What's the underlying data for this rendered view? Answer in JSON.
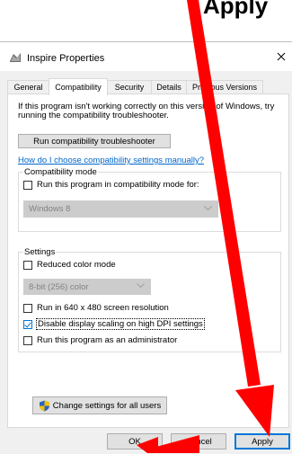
{
  "caption": {
    "text": "Apply"
  },
  "window": {
    "title": "Inspire Properties",
    "app_icon": "app-icon",
    "close_symbol": "✕"
  },
  "tabs": [
    {
      "label": "General",
      "active": false
    },
    {
      "label": "Compatibility",
      "active": true
    },
    {
      "label": "Security",
      "active": false
    },
    {
      "label": "Details",
      "active": false
    },
    {
      "label": "Previous Versions",
      "active": false
    }
  ],
  "compat": {
    "intro_text": "If this program isn't working correctly on this version of Windows, try running the compatibility troubleshooter.",
    "troubleshooter_button": "Run compatibility troubleshooter",
    "help_link": "How do I choose compatibility settings manually?",
    "mode_group": {
      "label": "Compatibility mode",
      "checkbox_label": "Run this program in compatibility mode for:",
      "checked": false,
      "os_select_value": "Windows 8"
    },
    "settings_group": {
      "label": "Settings",
      "reduced_color_label": "Reduced color mode",
      "reduced_color_checked": false,
      "color_select_value": "8-bit (256) color",
      "run_640_label": "Run in 640 x 480 screen resolution",
      "run_640_checked": false,
      "dpi_label": "Disable display scaling on high DPI settings",
      "dpi_checked": true,
      "admin_label": "Run this program as an administrator",
      "admin_checked": false
    },
    "all_users_button": "Change settings for all users"
  },
  "footer": {
    "ok_label": "OK",
    "cancel_label": "Cancel",
    "apply_label": "Apply"
  },
  "annotation_color": "#ff0000"
}
